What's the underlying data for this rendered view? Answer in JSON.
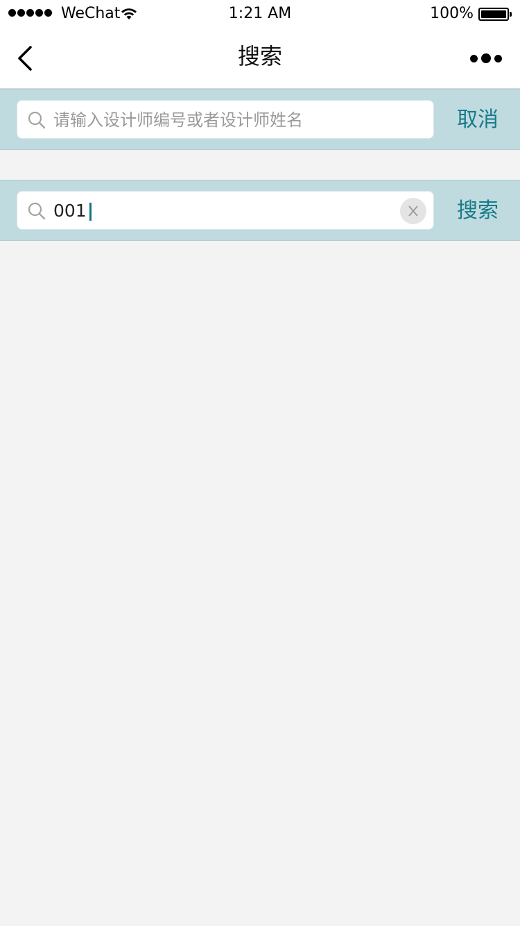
{
  "status_bar": {
    "carrier": "WeChat",
    "time": "1:21 AM",
    "battery_percent": "100%",
    "battery_level": 1.0,
    "signal_bars": 5
  },
  "nav": {
    "title": "搜索"
  },
  "search_inactive": {
    "placeholder": "请输入设计师编号或者设计师姓名",
    "action_label": "取消"
  },
  "search_active": {
    "value": "001",
    "action_label": "搜索"
  },
  "colors": {
    "accent": "#177a8a",
    "search_bar_bg": "#c0dbdf",
    "page_bg": "#f3f3f3"
  },
  "icons": {
    "back": "chevron-left-icon",
    "more": "more-dots-icon",
    "search": "search-icon",
    "clear": "clear-icon",
    "wifi": "wifi-icon",
    "battery": "battery-icon"
  }
}
